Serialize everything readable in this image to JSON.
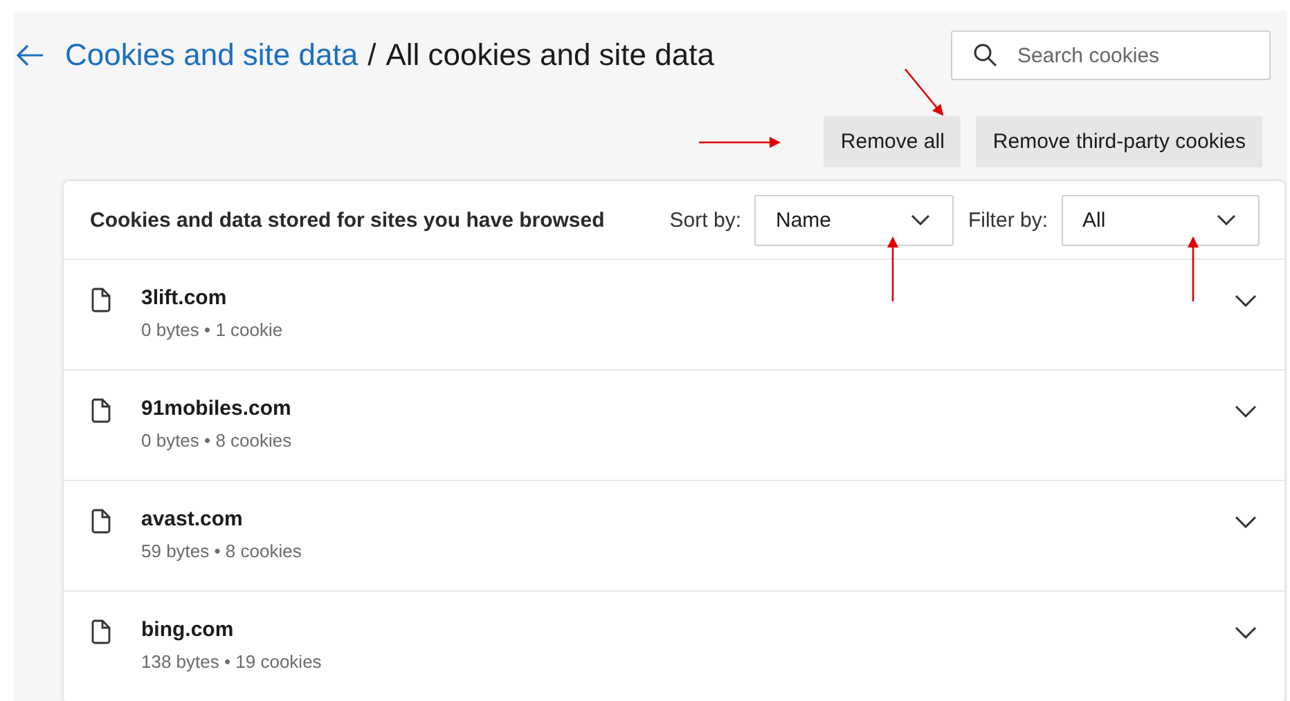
{
  "header": {
    "parent_link": "Cookies and site data",
    "separator": "/",
    "title": "All cookies and site data"
  },
  "search": {
    "placeholder": "Search cookies"
  },
  "buttons": [
    "Remove all",
    "Remove third-party cookies"
  ],
  "panel": {
    "description": "Cookies and data stored for sites you have browsed",
    "sort": {
      "label": "Sort by:",
      "value": "Name"
    },
    "filter": {
      "label": "Filter by:",
      "value": "All"
    },
    "sites": [
      {
        "name": "3lift.com",
        "details": "0 bytes • 1 cookie",
        "expanded": false
      },
      {
        "name": "91mobiles.com",
        "details": "0 bytes • 8 cookies",
        "expanded": false
      },
      {
        "name": "avast.com",
        "details": "59 bytes • 8 cookies",
        "expanded": false
      },
      {
        "name": "bing.com",
        "details": "138 bytes • 19 cookies",
        "expanded": false
      }
    ]
  }
}
